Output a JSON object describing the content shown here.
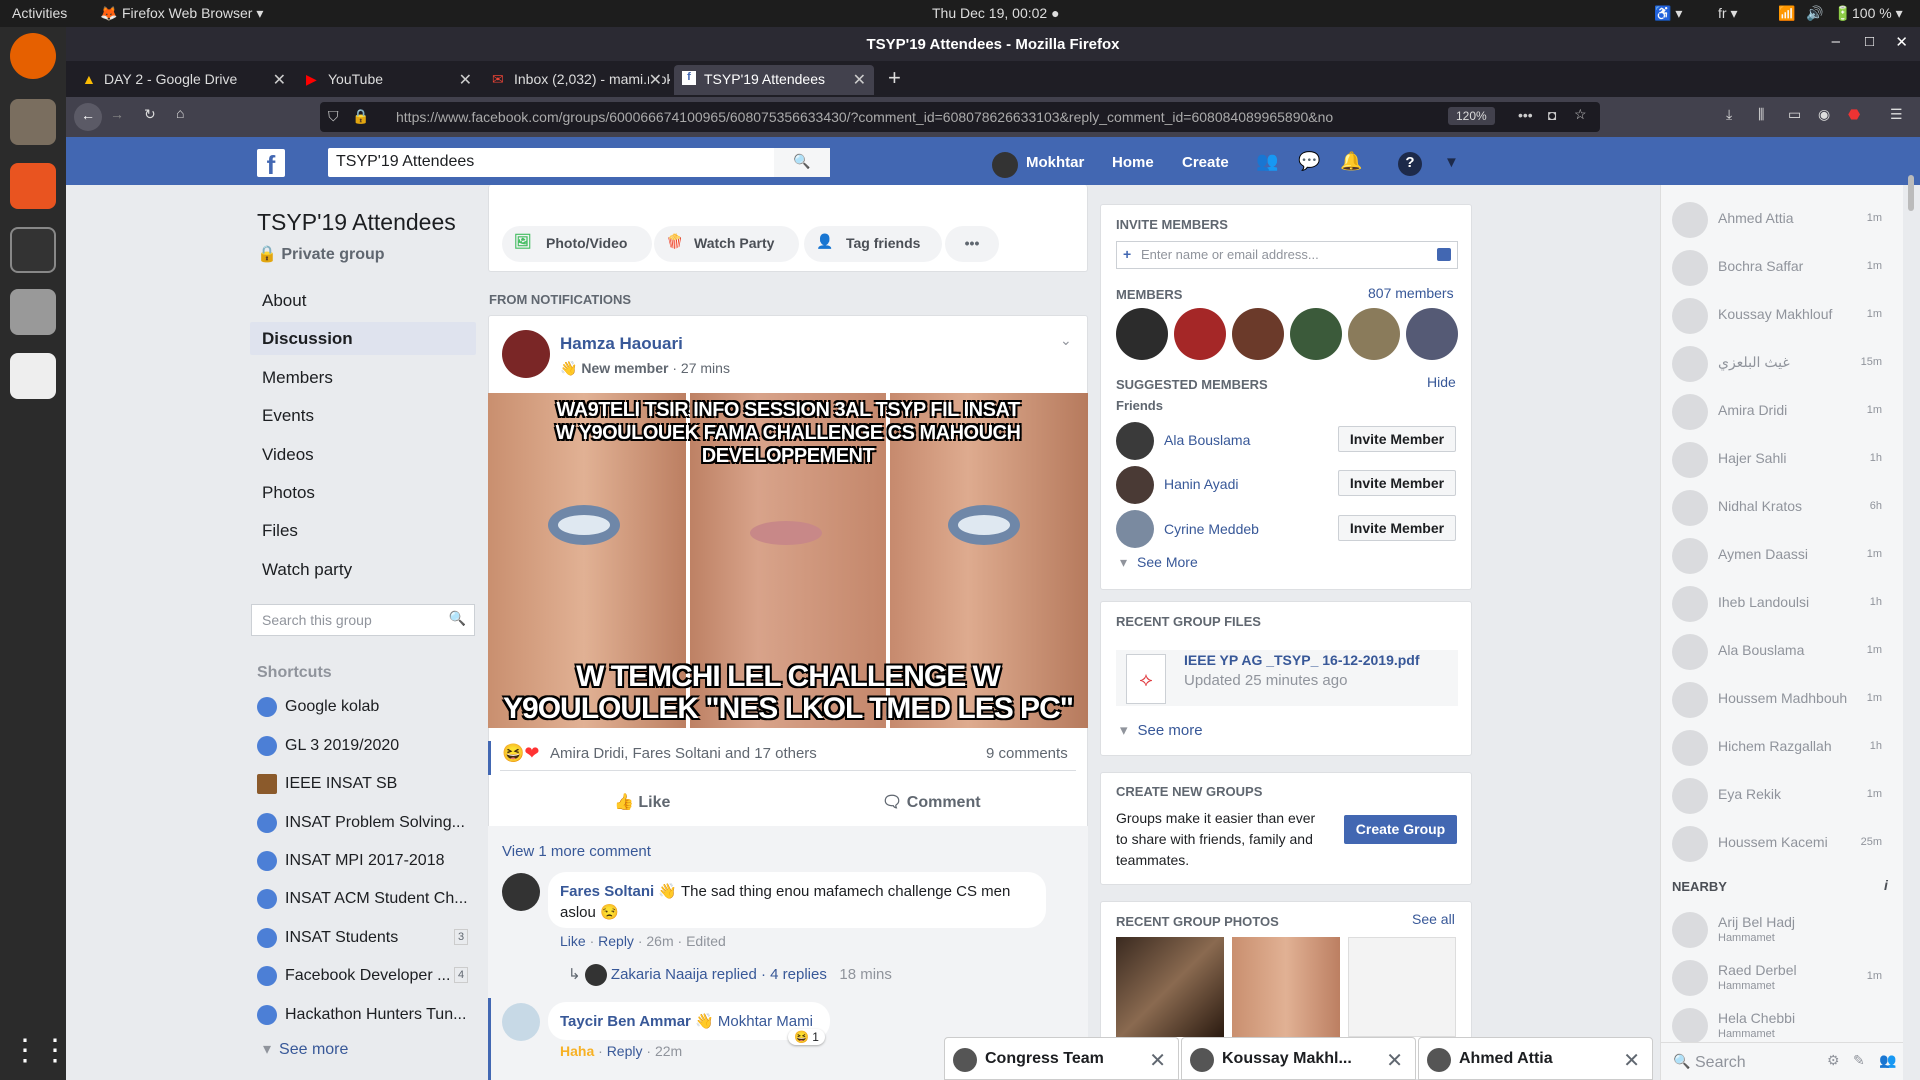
{
  "os": {
    "activities": "Activities",
    "app_menu": "Firefox Web Browser ▾",
    "clock": "Thu Dec 19, 00:02 ●",
    "lang": "fr ▾",
    "battery": "100 % ▾"
  },
  "browser": {
    "window_title": "TSYP'19 Attendees - Mozilla Firefox",
    "tabs": [
      {
        "label": "DAY 2 - Google Drive"
      },
      {
        "label": "YouTube"
      },
      {
        "label": "Inbox (2,032) - mami.mok"
      },
      {
        "label": "TSYP'19 Attendees"
      }
    ],
    "url": "https://www.facebook.com/groups/600066674100965/608075356633430/?comment_id=608078626633103&reply_comment_id=608084089965890&no",
    "zoom": "120%"
  },
  "fb_header": {
    "search_value": "TSYP'19 Attendees",
    "user_name": "Mokhtar",
    "home": "Home",
    "create": "Create"
  },
  "group": {
    "title": "TSYP'19 Attendees",
    "privacy": "Private group",
    "nav": [
      "About",
      "Discussion",
      "Members",
      "Events",
      "Videos",
      "Photos",
      "Files",
      "Watch party"
    ],
    "search_placeholder": "Search this group",
    "shortcuts_title": "Shortcuts",
    "shortcuts": [
      {
        "label": "Google kolab",
        "badge": ""
      },
      {
        "label": "GL 3 2019/2020",
        "badge": ""
      },
      {
        "label": "IEEE INSAT SB",
        "badge": ""
      },
      {
        "label": "INSAT Problem Solving...",
        "badge": ""
      },
      {
        "label": "INSAT MPI 2017-2018",
        "badge": ""
      },
      {
        "label": "INSAT ACM Student Ch...",
        "badge": ""
      },
      {
        "label": "INSAT Students",
        "badge": "3"
      },
      {
        "label": "Facebook Developer ...",
        "badge": "4"
      },
      {
        "label": "Hackathon Hunters Tun...",
        "badge": ""
      }
    ],
    "see_more": "See more"
  },
  "composer": {
    "photo_video": "Photo/Video",
    "watch_party": "Watch Party",
    "tag_friends": "Tag friends",
    "more": "•••"
  },
  "feed": {
    "section_label": "FROM NOTIFICATIONS",
    "post": {
      "author": "Hamza Haouari",
      "badge": "New member",
      "time": "· 27 mins",
      "meme_top": "WA9TELI TSIR INFO SESSION 3AL TSYP FIL INSAT\nW Y9OULOUEK FAMA CHALLENGE CS MAHOUCH DEVELOPPEMENT",
      "meme_bottom": "W TEMCHI LEL CHALLENGE W\nY9OULOULEK \"NES LKOL TMED LES PC\"",
      "reactions": "Amira Dridi, Fares Soltani and 17 others",
      "comments_count": "9 comments",
      "like": "Like",
      "comment": "Comment",
      "view_more": "View 1 more comment",
      "comment1": {
        "author": "Fares Soltani",
        "text": "The sad thing enou mafamech challenge CS men aslou 😒",
        "like": "Like",
        "reply": "Reply",
        "time": "26m",
        "edited": "Edited"
      },
      "replies": {
        "who": "Zakaria Naaija replied",
        "count": "· 4 replies",
        "time": "18 mins"
      },
      "comment2": {
        "author": "Taycir Ben Ammar",
        "mention": "Mokhtar Mami",
        "haha": "Haha",
        "reply": "Reply",
        "time": "22m",
        "react_count": "1"
      }
    }
  },
  "right": {
    "invite_title": "INVITE MEMBERS",
    "invite_placeholder": "Enter name or email address...",
    "members_title": "MEMBERS",
    "members_count": "807 members",
    "suggested_title": "SUGGESTED MEMBERS",
    "hide": "Hide",
    "friends": "Friends",
    "suggested": [
      {
        "name": "Ala Bouslama"
      },
      {
        "name": "Hanin Ayadi"
      },
      {
        "name": "Cyrine Meddeb"
      }
    ],
    "invite_btn": "Invite Member",
    "see_more": "See More",
    "files_title": "RECENT GROUP FILES",
    "file_name": "IEEE YP AG _TSYP_ 16-12-2019.pdf",
    "file_updated": "Updated 25 minutes ago",
    "files_see_more": "See more",
    "create_title": "CREATE NEW GROUPS",
    "create_text": "Groups make it easier than ever to share with friends, family and teammates.",
    "create_btn": "Create Group",
    "photos_title": "RECENT GROUP PHOTOS",
    "see_all": "See all"
  },
  "chat": {
    "contacts": [
      {
        "name": "Ahmed Attia",
        "time": "1m"
      },
      {
        "name": "Bochra Saffar",
        "time": "1m"
      },
      {
        "name": "Koussay Makhlouf",
        "time": "1m"
      },
      {
        "name": "غيث البلعزي",
        "time": "15m"
      },
      {
        "name": "Amira Dridi",
        "time": "1m"
      },
      {
        "name": "Hajer Sahli",
        "time": "1h"
      },
      {
        "name": "Nidhal Kratos",
        "time": "6h"
      },
      {
        "name": "Aymen Daassi",
        "time": "1m"
      },
      {
        "name": "Iheb Landoulsi",
        "time": "1h"
      },
      {
        "name": "Ala Bouslama",
        "time": "1m"
      },
      {
        "name": "Houssem Madhbouh",
        "time": "1m"
      },
      {
        "name": "Hichem Razgallah",
        "time": "1h"
      },
      {
        "name": "Eya Rekik",
        "time": "1m"
      },
      {
        "name": "Houssem Kacemi",
        "time": "25m"
      }
    ],
    "nearby_title": "NEARBY",
    "nearby": [
      {
        "name": "Arij Bel Hadj",
        "place": "Hammamet",
        "time": ""
      },
      {
        "name": "Raed Derbel",
        "place": "Hammamet",
        "time": "1m"
      },
      {
        "name": "Hela Chebbi",
        "place": "Hammamet",
        "time": ""
      }
    ],
    "search_placeholder": "Search",
    "open_boxes": [
      {
        "name": "Congress Team"
      },
      {
        "name": "Koussay Makhl..."
      },
      {
        "name": "Ahmed Attia"
      }
    ]
  }
}
